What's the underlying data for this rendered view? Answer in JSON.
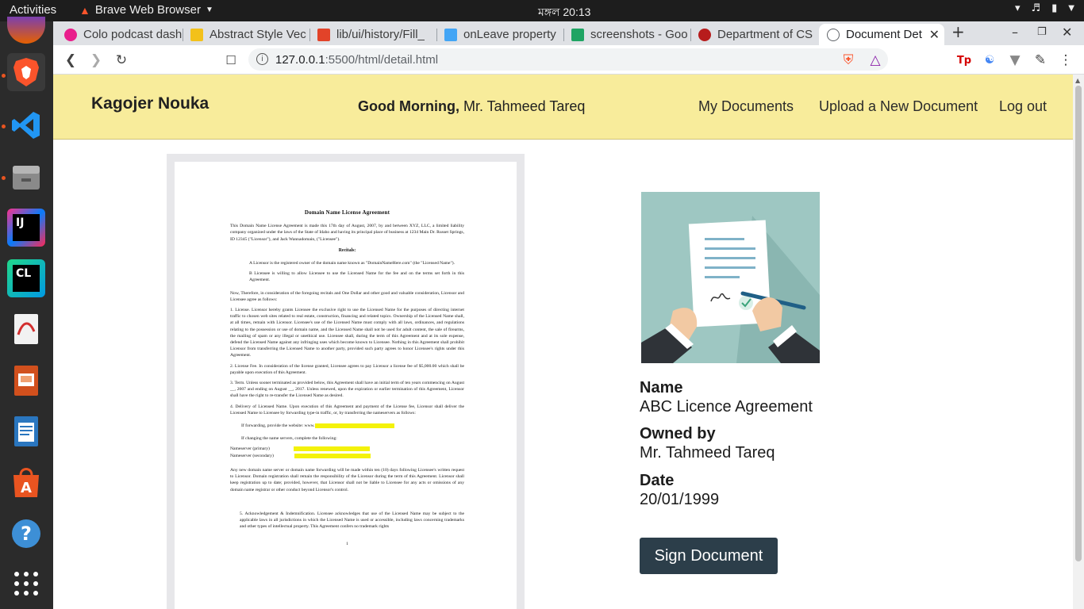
{
  "system_bar": {
    "activities": "Activities",
    "app_name": "Brave Web Browser",
    "clock": "মঙ্গল 20:13"
  },
  "dock": {
    "items": [
      "firefox",
      "brave",
      "vscode",
      "files",
      "intellij-idea",
      "clion",
      "document-viewer",
      "libreoffice-impress",
      "libreoffice-writer",
      "ubuntu-software",
      "help",
      "show-applications"
    ]
  },
  "tabs": [
    {
      "label": "Colo podcast dash",
      "color": "#e91e8c"
    },
    {
      "label": "Abstract Style Vec",
      "color": "#f3c11a"
    },
    {
      "label": "lib/ui/history/Fill_",
      "color": "#e24329"
    },
    {
      "label": "onLeave property",
      "color": "#42a5f5"
    },
    {
      "label": "screenshots - Goo",
      "color": "#1fa463"
    },
    {
      "label": "Department of CS",
      "color": "#b71c1c"
    },
    {
      "label": "Document Det",
      "color": "#5f6368"
    }
  ],
  "address": {
    "host": "127.0.0.1",
    "path": ":5500/html/detail.html"
  },
  "header": {
    "brand": "Kagojer Nouka",
    "greeting_bold": "Good Morning,",
    "greeting_name": " Mr. Tahmeed Tareq",
    "nav": [
      "My Documents",
      "Upload a New Document",
      "Log out"
    ]
  },
  "document_preview": {
    "title": "Domain Name License Agreement",
    "intro": "This Domain Name License Agreement is made this 17th day of August, 2007, by and between XYZ, LLC, a limited liability company organized under the laws of the State of Idaho and having its principal place of business at 1234 Main Dr. Russet Springs, ID 12345 (\"Licensor\"), and Jack Wannadomain, (\"Licensee\").",
    "recitals_heading": "Recitals:",
    "recital_a": "A     Licensor is the registered owner of the domain name known as \"DomainNameHere.com\" (the \"Licensed Name\").",
    "recital_b": "B     Licensee is willing to allow Licensee to use the Licensed Name for the fee and on the terms set forth in this Agreement.",
    "therefore": "Now, Therefore, in consideration of the foregoing recitals and One Dollar and other good and valuable consideration, Licensor and Licensee agree as follows:",
    "clause_1": "1. License. Licensor hereby grants Licensee the exclusive right to use the Licensed Name for the purposes of directing internet traffic to chosen web sites related to real estate, construction, financing and related topics. Ownership of the Licensed Name shall, at all times, remain with Licensor. Licensee's use of the Licensed Name must comply with all laws, ordinances, and regulations relating to the possession or use of domain name, and the Licensed Name shall not be used for adult content, the sale of firearms, the mailing of spam or any illegal or unethical use. Licensee shall, during the term of this Agreement and at its sole expense, defend the Licensed Name against any infringing uses which become known to Licensee. Nothing in this Agreement shall prohibit Licensor from transferring the Licensed Name to another party, provided such party agrees to honor Licensee's rights under this Agreement.",
    "clause_2": "2. License Fee. In consideration of the license granted, Licensee agrees to pay Licensor a license fee of $5,000.00 which shall be payable upon execution of this Agreement.",
    "clause_3": "3. Term. Unless sooner terminated as provided below, this Agreement shall have an initial term of ten years commencing on August __, 2007 and ending on August __, 2017. Unless renewed, upon the expiration or earlier termination of this Agreement, Licensor shall have the right to re-transfer the Licensed Name as desired.",
    "clause_4": "4. Delivery of Licensed Name. Upon execution of this Agreement and payment of the License fee, Licensor shall deliver the Licensed Name to Licensee by forwarding type-in traffic, or, by transferring the nameservers as follows:",
    "forwarding": "If forwarding, provide the website:  www.",
    "nameservers_intro": "If changing the name servers, complete the following:",
    "ns_primary": "Nameserver (primary)",
    "ns_secondary": "Nameserver (secondary)",
    "change_note": "Any new domain name server or domain name forwarding will be made within ten (10) days following Licensee's written request to Licensor. Domain registration shall remain the responsibility of the Licensor during the term of this Agreement. Licensor shall keep registration up to date; provided, however, that Licensor shall not be liable to Licensee for any acts or omissions of any domain name registrar or other conduct beyond Licensor's control.",
    "clause_5": "5. Acknowledgement & Indemnification. Licensee acknowledges that use of the Licensed Name may be subject to the applicable laws in all jurisdictions in which the Licensed Name is used or accessible, including laws concerning trademarks and other types of intellectual property. This Agreement confers no trademark rights",
    "page_number": "1"
  },
  "details": {
    "name_label": "Name",
    "name_value": "ABC Licence Agreement",
    "owner_label": "Owned by",
    "owner_value": "Mr. Tahmeed Tareq",
    "date_label": "Date",
    "date_value": "20/01/1999"
  },
  "actions": {
    "sign_label": "Sign Document"
  },
  "colors": {
    "header_bg": "#f8ec9b",
    "button_bg": "#2c3e4a",
    "illustration_bg": "#9ec7c2"
  }
}
